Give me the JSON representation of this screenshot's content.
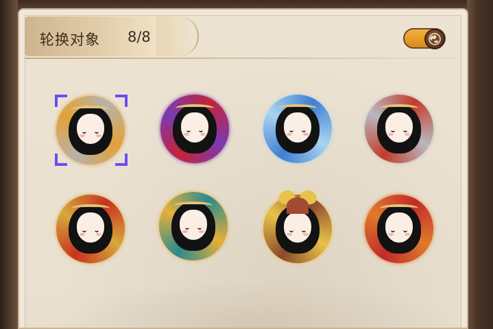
{
  "header": {
    "title": "轮换对象",
    "count": "8/8"
  },
  "toggle": {
    "state": "on",
    "accent": "#f2b23c"
  },
  "colors": {
    "panel": "#efe7da",
    "selection": "#6a4df0"
  },
  "avatars": [
    {
      "id": "a1",
      "theme": "silver-dragon",
      "ring": "#b7b2aa",
      "accent": "#e2a23a",
      "selected": true
    },
    {
      "id": "a2",
      "theme": "crimson-flame",
      "ring": "#c3243a",
      "accent": "#7a3ab0",
      "selected": false
    },
    {
      "id": "a3",
      "theme": "azure-wave",
      "ring": "#3f7fd2",
      "accent": "#a9d4f0",
      "selected": false
    },
    {
      "id": "a4",
      "theme": "red-silver",
      "ring": "#c43b2a",
      "accent": "#b8b8c0",
      "selected": false
    },
    {
      "id": "a5",
      "theme": "crimson-gold",
      "ring": "#c83220",
      "accent": "#d7a83a",
      "selected": false
    },
    {
      "id": "a6",
      "theme": "teal-dragon",
      "ring": "#2a8a8e",
      "accent": "#e4b03a",
      "selected": false
    },
    {
      "id": "a7",
      "theme": "samurai-helmet",
      "ring": "#8a4a2c",
      "accent": "#e8c24a",
      "selected": false
    },
    {
      "id": "a8",
      "theme": "crimson-lantern",
      "ring": "#c02a2a",
      "accent": "#e07a2a",
      "selected": false
    }
  ]
}
